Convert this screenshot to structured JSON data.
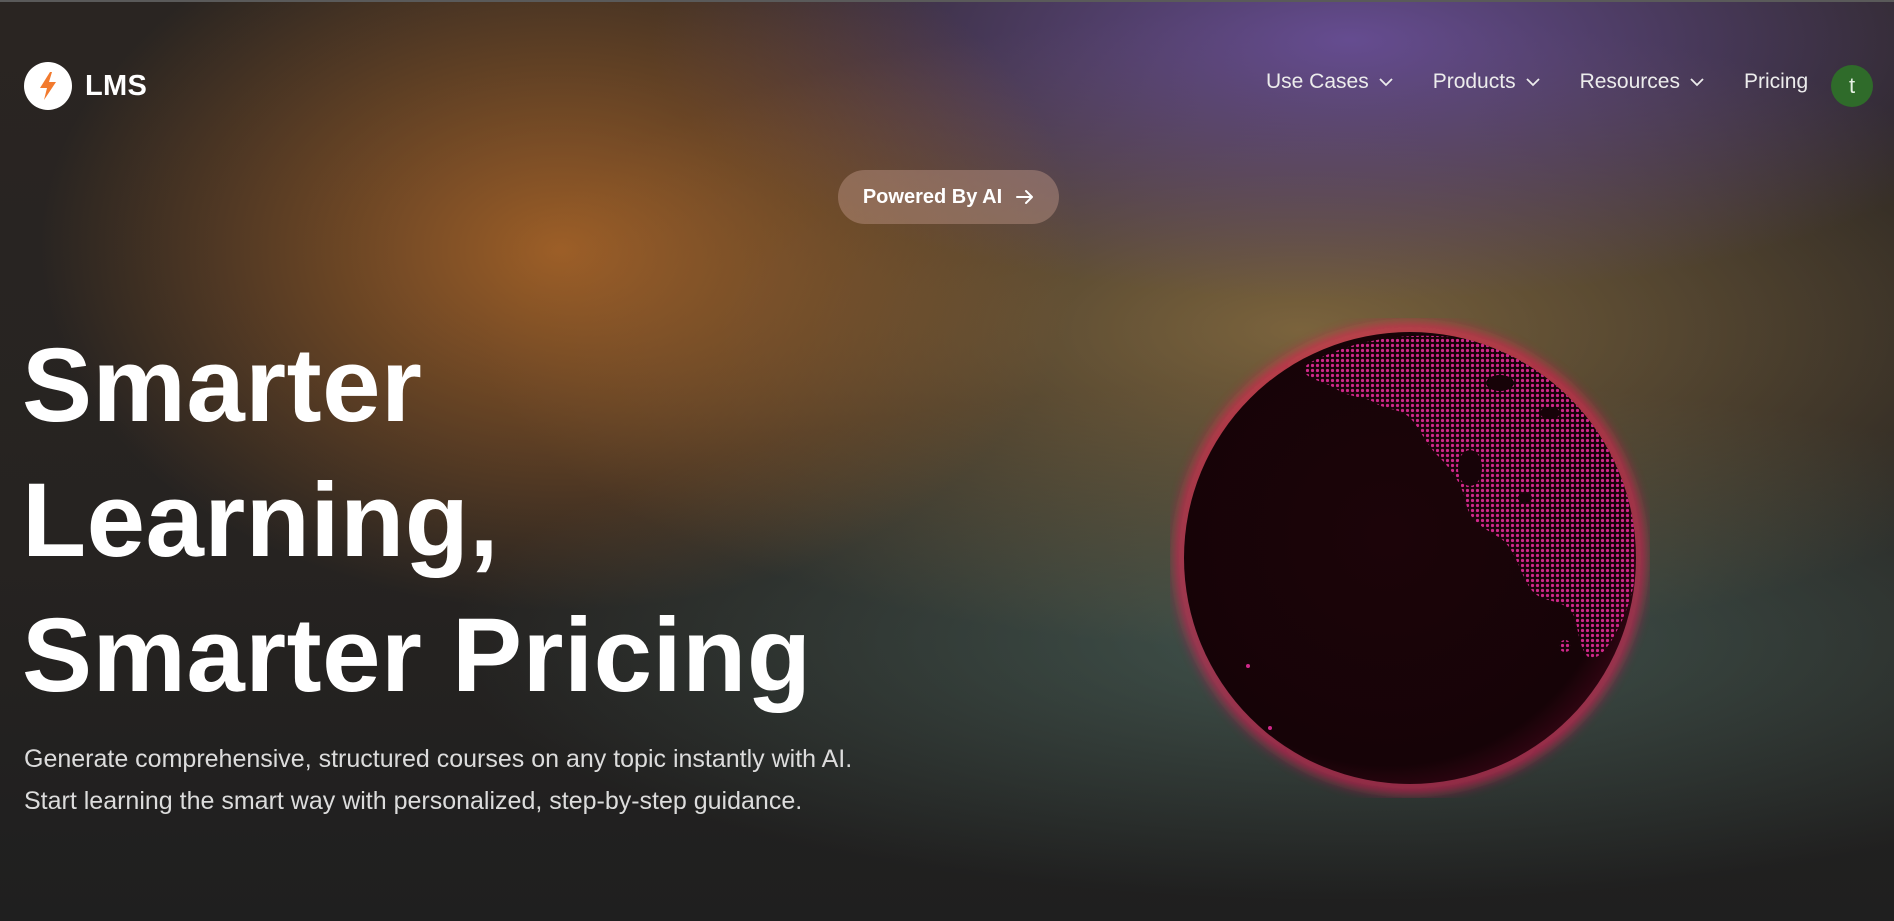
{
  "brand": {
    "name": "LMS",
    "logo_icon": "lightning-bolt-icon",
    "logo_color": "#f27a2e"
  },
  "nav": {
    "items": [
      {
        "label": "Use Cases",
        "has_dropdown": true
      },
      {
        "label": "Products",
        "has_dropdown": true
      },
      {
        "label": "Resources",
        "has_dropdown": true
      },
      {
        "label": "Pricing",
        "has_dropdown": false
      }
    ],
    "avatar_initial": "t",
    "avatar_color": "#2f6b2a"
  },
  "badge": {
    "label": "Powered By AI",
    "icon": "arrow-right-icon"
  },
  "hero": {
    "headline_lines": [
      "Smarter",
      "Learning,",
      "Smarter Pricing"
    ],
    "subtext": "Generate comprehensive, structured courses on any topic instantly with AI. Start learning the smart way with personalized, step-by-step guidance."
  },
  "globe": {
    "glow_color": "#ff1f5a",
    "land_color": "#d0288a",
    "ocean_color": "#170308"
  }
}
